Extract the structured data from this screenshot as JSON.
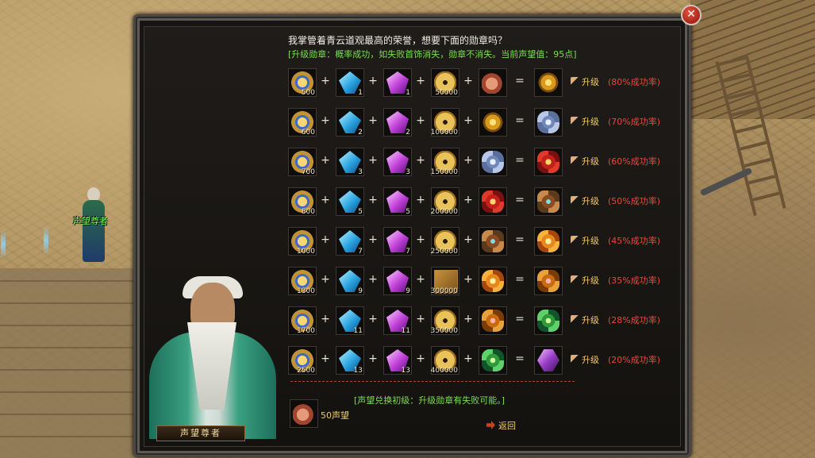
{
  "npc": {
    "name": "声望尊者"
  },
  "dialog": {
    "close": "✕",
    "intro": "我掌管着青云道观最高的荣誉，想要下面的勋章吗？",
    "rule": "[升级勋章：概率成功，如失败首饰消失，勋章不消失。当前声望值：95点]"
  },
  "recipes": [
    {
      "medal_count": "500",
      "blue": "1",
      "purple": "1",
      "gold": "50000",
      "rate": "(80%成功率)"
    },
    {
      "medal_count": "600",
      "blue": "2",
      "purple": "2",
      "gold": "100000",
      "rate": "(70%成功率)"
    },
    {
      "medal_count": "700",
      "blue": "3",
      "purple": "3",
      "gold": "150000",
      "rate": "(60%成功率)"
    },
    {
      "medal_count": "800",
      "blue": "5",
      "purple": "5",
      "gold": "200000",
      "rate": "(50%成功率)"
    },
    {
      "medal_count": "1000",
      "blue": "7",
      "purple": "7",
      "gold": "250000",
      "rate": "(45%成功率)"
    },
    {
      "medal_count": "1300",
      "blue": "9",
      "purple": "9",
      "gold": "300000",
      "rate": "(35%成功率)"
    },
    {
      "medal_count": "1700",
      "blue": "11",
      "purple": "11",
      "gold": "350000",
      "rate": "(28%成功率)"
    },
    {
      "medal_count": "2500",
      "blue": "13",
      "purple": "13",
      "gold": "400000",
      "rate": "(20%成功率)"
    }
  ],
  "ops": {
    "plus": "+",
    "equals": "="
  },
  "upgrade_label": "升级",
  "exchange": {
    "note": "[声望兑换初级：升级勋章有失败可能。]",
    "cost": "50声望",
    "back": "返回"
  },
  "portrait": {
    "name": "声望尊者"
  },
  "icons": {
    "in_medal": "blue-medal-icon",
    "blue_gem": "blue-crystal-icon",
    "purple_gem": "purple-crystal-icon",
    "coin": "gold-coin-icon",
    "inputs": [
      "orange-pouch-icon",
      "gold-medal-icon",
      "silver-badge-icon",
      "red-badge-icon",
      "bronze-badge-icon",
      "orange-badge-icon",
      "amber-badge-icon",
      "green-badge-icon"
    ],
    "outputs": [
      "gold-medal-icon",
      "silver-badge-icon",
      "red-badge-icon",
      "bronze-badge-icon",
      "orange-badge-icon",
      "amber-badge-icon",
      "green-badge-icon",
      "purple-gem-icon"
    ]
  },
  "colors": {
    "rule_text": "#7ddc52",
    "rate_text": "#e44a3a",
    "upgrade_text": "#f0c96a"
  }
}
